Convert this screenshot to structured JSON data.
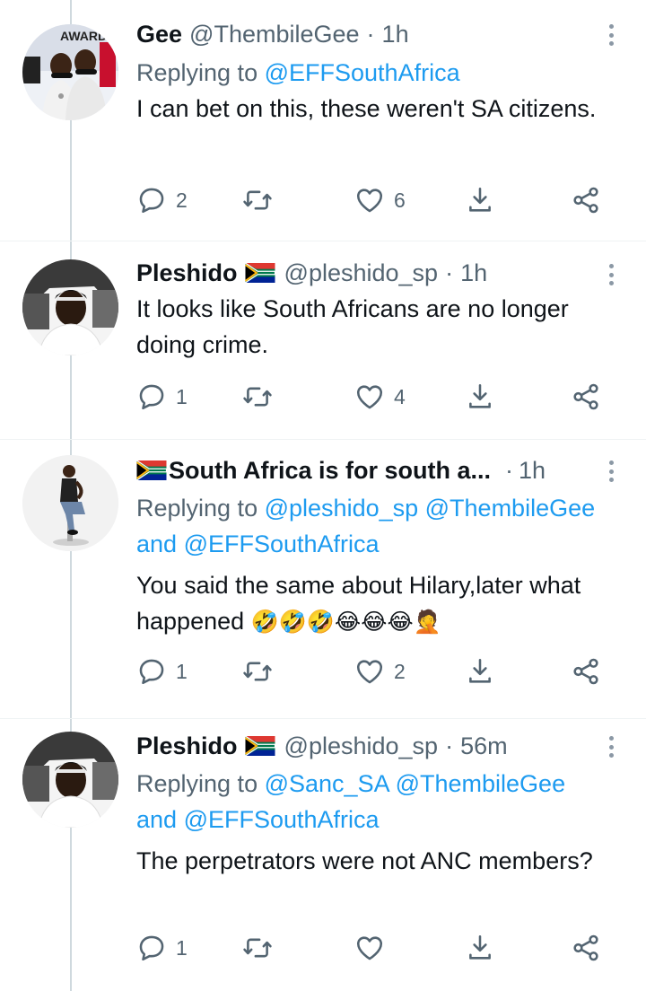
{
  "tweets": [
    {
      "name": "Gee",
      "handle": "@ThembileGee",
      "time": "1h",
      "replying_prefix": "Replying to",
      "reply_mentions_line1": "@EFFSouthAfrica",
      "reply_and": "",
      "reply_mentions_line2": "",
      "text": "I can bet on this, these weren't SA citizens.",
      "emoji": "",
      "replies": "2",
      "likes": "6",
      "avatar_text": "AWARD BET"
    },
    {
      "name": "Pleshido",
      "handle": "@pleshido_sp",
      "time": "1h",
      "text": "It looks like South Africans are no longer doing crime.",
      "replies": "1",
      "likes": "4"
    },
    {
      "name": "South Africa is for south a...",
      "time": "1h",
      "replying_prefix": "Replying to",
      "reply_mentions_line1": "@pleshido_sp @ThembileGee",
      "reply_and": "and",
      "reply_mentions_line2": "@EFFSouthAfrica",
      "text": "You said the same about Hilary,later what happened",
      "emoji": "🤣🤣🤣😂😂😂🤦",
      "replies": "1",
      "likes": "2"
    },
    {
      "name": "Pleshido",
      "handle": "@pleshido_sp",
      "time": "56m",
      "replying_prefix": "Replying to",
      "reply_mentions_line1": "@Sanc_SA @ThembileGee",
      "reply_and": "and",
      "reply_mentions_line2": "@EFFSouthAfrica",
      "text": "The perpetrators were not ANC members?",
      "replies": "1",
      "likes": ""
    }
  ],
  "icons": {
    "reply": "reply-icon",
    "retweet": "retweet-icon",
    "like": "heart-icon",
    "share": "share-icon",
    "more": "share-nodes-icon",
    "menu": "more-vertical-icon"
  },
  "colors": {
    "text": "#0f1419",
    "secondary": "#536471",
    "link": "#1d9bf0",
    "thread_line": "#cfd9de"
  }
}
